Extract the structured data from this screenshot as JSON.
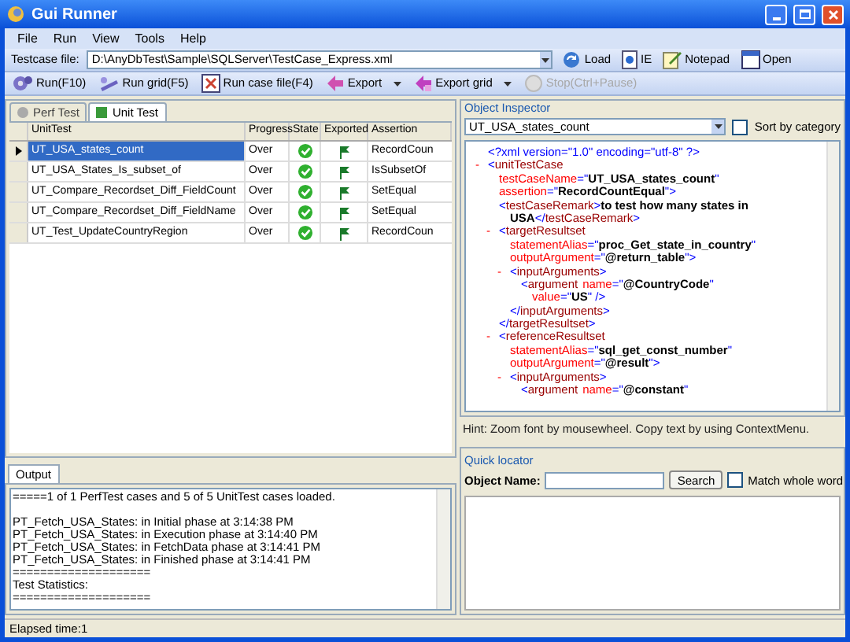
{
  "window": {
    "title": "Gui Runner"
  },
  "menu": [
    "File",
    "Run",
    "View",
    "Tools",
    "Help"
  ],
  "testcase_bar": {
    "label": "Testcase file:",
    "value": "D:\\AnyDbTest\\Sample\\SQLServer\\TestCase_Express.xml",
    "buttons": [
      {
        "label": "Load",
        "kind": "load"
      },
      {
        "label": "IE",
        "kind": "ie"
      },
      {
        "label": "Notepad",
        "kind": "notepad"
      },
      {
        "label": "Open",
        "kind": "open"
      }
    ]
  },
  "toolbar": [
    {
      "label": "Run(F10)",
      "kind": "run",
      "dropdown": false,
      "disabled": false
    },
    {
      "label": "Run grid(F5)",
      "kind": "grid",
      "dropdown": false,
      "disabled": false
    },
    {
      "label": "Run case file(F4)",
      "kind": "file",
      "dropdown": false,
      "disabled": false
    },
    {
      "label": "Export",
      "kind": "export",
      "dropdown": true,
      "disabled": false
    },
    {
      "label": "Export grid",
      "kind": "exportgrid",
      "dropdown": true,
      "disabled": false
    },
    {
      "label": "Stop(Ctrl+Pause)",
      "kind": "stop",
      "dropdown": false,
      "disabled": true
    }
  ],
  "test_tabs": [
    {
      "label": "Perf Test",
      "selected": false
    },
    {
      "label": "Unit Test",
      "selected": true
    }
  ],
  "table": {
    "columns": [
      "UnitTest",
      "Progress",
      "State",
      "Exported",
      "Assertion"
    ],
    "rows": [
      {
        "name": "UT_USA_states_count",
        "progress": "Over",
        "passed": true,
        "exported": true,
        "assertion": "RecordCoun",
        "selected": true
      },
      {
        "name": "UT_USA_States_Is_subset_of",
        "progress": "Over",
        "passed": true,
        "exported": true,
        "assertion": "IsSubsetOf",
        "selected": false
      },
      {
        "name": "UT_Compare_Recordset_Diff_FieldCount",
        "progress": "Over",
        "passed": true,
        "exported": true,
        "assertion": "SetEqual",
        "selected": false
      },
      {
        "name": "UT_Compare_Recordset_Diff_FieldName",
        "progress": "Over",
        "passed": true,
        "exported": true,
        "assertion": "SetEqual",
        "selected": false
      },
      {
        "name": "UT_Test_UpdateCountryRegion",
        "progress": "Over",
        "passed": true,
        "exported": true,
        "assertion": "RecordCoun",
        "selected": false
      }
    ]
  },
  "output": {
    "tab": "Output",
    "blocks": [
      [
        "=====1 of 1 PerfTest cases and 5 of 5 UnitTest cases loaded."
      ],
      [
        "PT_Fetch_USA_States: in Initial phase at 3:14:38 PM",
        "PT_Fetch_USA_States: in Execution phase at 3:14:40 PM",
        "PT_Fetch_USA_States: in FetchData phase at 3:14:41 PM",
        "PT_Fetch_USA_States: in Finished phase at 3:14:41 PM",
        "====================",
        "Test Statistics:",
        "===================="
      ]
    ]
  },
  "status_bar": "Elapsed time:1",
  "object_inspector": {
    "title": "Object Inspector",
    "selection": "UT_USA_states_count",
    "sort_label": "Sort by category",
    "sort_checked": false,
    "declaration": "<?xml version=\"1.0\" encoding=\"utf-8\" ?>",
    "xml": {
      "toggle": "-",
      "open": [
        [
          {
            "kind": "punct",
            "text": "<"
          },
          {
            "kind": "tag",
            "text": "unitTestCase"
          }
        ],
        [
          {
            "kind": "attr",
            "text": "testCaseName"
          },
          {
            "kind": "punct",
            "text": "=\""
          },
          {
            "kind": "value",
            "text": "UT_USA_states_count"
          },
          {
            "kind": "punct",
            "text": "\""
          }
        ],
        [
          {
            "kind": "attr",
            "text": "assertion"
          },
          {
            "kind": "punct",
            "text": "=\""
          },
          {
            "kind": "value",
            "text": "RecordCountEqual"
          },
          {
            "kind": "punct",
            "text": "\">"
          }
        ]
      ],
      "children": [
        {
          "open": [
            [
              {
                "kind": "punct",
                "text": "<"
              },
              {
                "kind": "tag",
                "text": "testCaseRemark"
              },
              {
                "kind": "punct",
                "text": ">"
              },
              {
                "kind": "value",
                "text": "to test how many states in"
              }
            ],
            [
              {
                "kind": "value",
                "text": "USA"
              },
              {
                "kind": "punct",
                "text": "</"
              },
              {
                "kind": "tag",
                "text": "testCaseRemark"
              },
              {
                "kind": "punct",
                "text": ">"
              }
            ]
          ]
        },
        {
          "toggle": "-",
          "open": [
            [
              {
                "kind": "punct",
                "text": "<"
              },
              {
                "kind": "tag",
                "text": "targetResultset"
              }
            ],
            [
              {
                "kind": "attr",
                "text": "statementAlias"
              },
              {
                "kind": "punct",
                "text": "=\""
              },
              {
                "kind": "value",
                "text": "proc_Get_state_in_country"
              },
              {
                "kind": "punct",
                "text": "\""
              }
            ],
            [
              {
                "kind": "attr",
                "text": "outputArgument"
              },
              {
                "kind": "punct",
                "text": "=\""
              },
              {
                "kind": "value",
                "text": "@return_table"
              },
              {
                "kind": "punct",
                "text": "\">"
              }
            ]
          ],
          "children": [
            {
              "toggle": "-",
              "open": [
                [
                  {
                    "kind": "punct",
                    "text": "<"
                  },
                  {
                    "kind": "tag",
                    "text": "inputArguments"
                  },
                  {
                    "kind": "punct",
                    "text": ">"
                  }
                ]
              ],
              "children": [
                {
                  "open": [
                    [
                      {
                        "kind": "punct",
                        "text": "<"
                      },
                      {
                        "kind": "tag",
                        "text": "argument"
                      },
                      {
                        "kind": "attr",
                        "text": "name"
                      },
                      {
                        "kind": "punct",
                        "text": "=\""
                      },
                      {
                        "kind": "value",
                        "text": "@CountryCode"
                      },
                      {
                        "kind": "punct",
                        "text": "\""
                      }
                    ],
                    [
                      {
                        "kind": "attr",
                        "text": "value"
                      },
                      {
                        "kind": "punct",
                        "text": "=\""
                      },
                      {
                        "kind": "value",
                        "text": "US"
                      },
                      {
                        "kind": "punct",
                        "text": "\" />"
                      }
                    ]
                  ]
                }
              ],
              "close": [
                {
                  "kind": "punct",
                  "text": "</"
                },
                {
                  "kind": "tag",
                  "text": "inputArguments"
                },
                {
                  "kind": "punct",
                  "text": ">"
                }
              ]
            }
          ],
          "close": [
            {
              "kind": "punct",
              "text": "</"
            },
            {
              "kind": "tag",
              "text": "targetResultset"
            },
            {
              "kind": "punct",
              "text": ">"
            }
          ]
        },
        {
          "toggle": "-",
          "open": [
            [
              {
                "kind": "punct",
                "text": "<"
              },
              {
                "kind": "tag",
                "text": "referenceResultset"
              }
            ],
            [
              {
                "kind": "attr",
                "text": "statementAlias"
              },
              {
                "kind": "punct",
                "text": "=\""
              },
              {
                "kind": "value",
                "text": "sql_get_const_number"
              },
              {
                "kind": "punct",
                "text": "\""
              }
            ],
            [
              {
                "kind": "attr",
                "text": "outputArgument"
              },
              {
                "kind": "punct",
                "text": "=\""
              },
              {
                "kind": "value",
                "text": "@result"
              },
              {
                "kind": "punct",
                "text": "\">"
              }
            ]
          ],
          "children": [
            {
              "toggle": "-",
              "open": [
                [
                  {
                    "kind": "punct",
                    "text": "<"
                  },
                  {
                    "kind": "tag",
                    "text": "inputArguments"
                  },
                  {
                    "kind": "punct",
                    "text": ">"
                  }
                ]
              ],
              "children": [
                {
                  "open": [
                    [
                      {
                        "kind": "punct",
                        "text": "<"
                      },
                      {
                        "kind": "tag",
                        "text": "argument"
                      },
                      {
                        "kind": "attr",
                        "text": "name"
                      },
                      {
                        "kind": "punct",
                        "text": "=\""
                      },
                      {
                        "kind": "value",
                        "text": "@constant"
                      },
                      {
                        "kind": "punct",
                        "text": "\""
                      }
                    ]
                  ]
                }
              ]
            }
          ]
        }
      ]
    },
    "hint": "Hint: Zoom font by mousewheel. Copy text by using ContextMenu."
  },
  "quick_locator": {
    "title": "Quick locator",
    "label": "Object Name:",
    "button": "Search",
    "match_label": "Match whole word",
    "match_checked": false
  }
}
